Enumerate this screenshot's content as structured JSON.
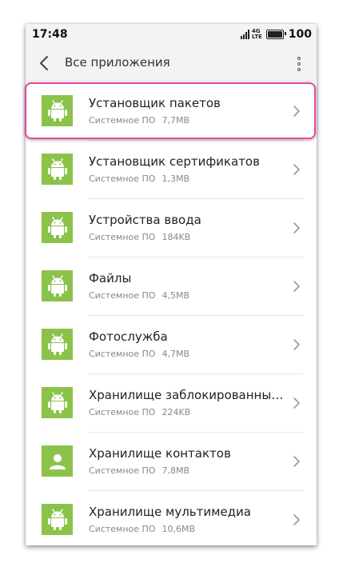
{
  "status": {
    "time": "17:48",
    "net_top": "4G",
    "net_bottom": "LTE",
    "battery": "100"
  },
  "header": {
    "title": "Все приложения",
    "back_icon": "chevron-left-icon",
    "more_icon": "more-vertical-icon"
  },
  "apps": [
    {
      "name": "Установщик пакетов",
      "type": "Системное ПО",
      "size": "7,7MB",
      "icon": "android-icon"
    },
    {
      "name": "Установщик сертификатов",
      "type": "Системное ПО",
      "size": "1,3MB",
      "icon": "android-icon"
    },
    {
      "name": "Устройства ввода",
      "type": "Системное ПО",
      "size": "184KB",
      "icon": "android-icon"
    },
    {
      "name": "Файлы",
      "type": "Системное ПО",
      "size": "4,5MB",
      "icon": "android-icon"
    },
    {
      "name": "Фотослужба",
      "type": "Системное ПО",
      "size": "4,7MB",
      "icon": "android-icon"
    },
    {
      "name": "Хранилище заблокированных…",
      "type": "Системное ПО",
      "size": "224KB",
      "icon": "android-icon"
    },
    {
      "name": "Хранилище контактов",
      "type": "Системное ПО",
      "size": "7,8MB",
      "icon": "person-icon"
    },
    {
      "name": "Хранилище мультимедиа",
      "type": "Системное ПО",
      "size": "10,6MB",
      "icon": "android-icon"
    }
  ],
  "colors": {
    "icon_bg": "#8bc34a",
    "highlight": "#e5479e"
  }
}
